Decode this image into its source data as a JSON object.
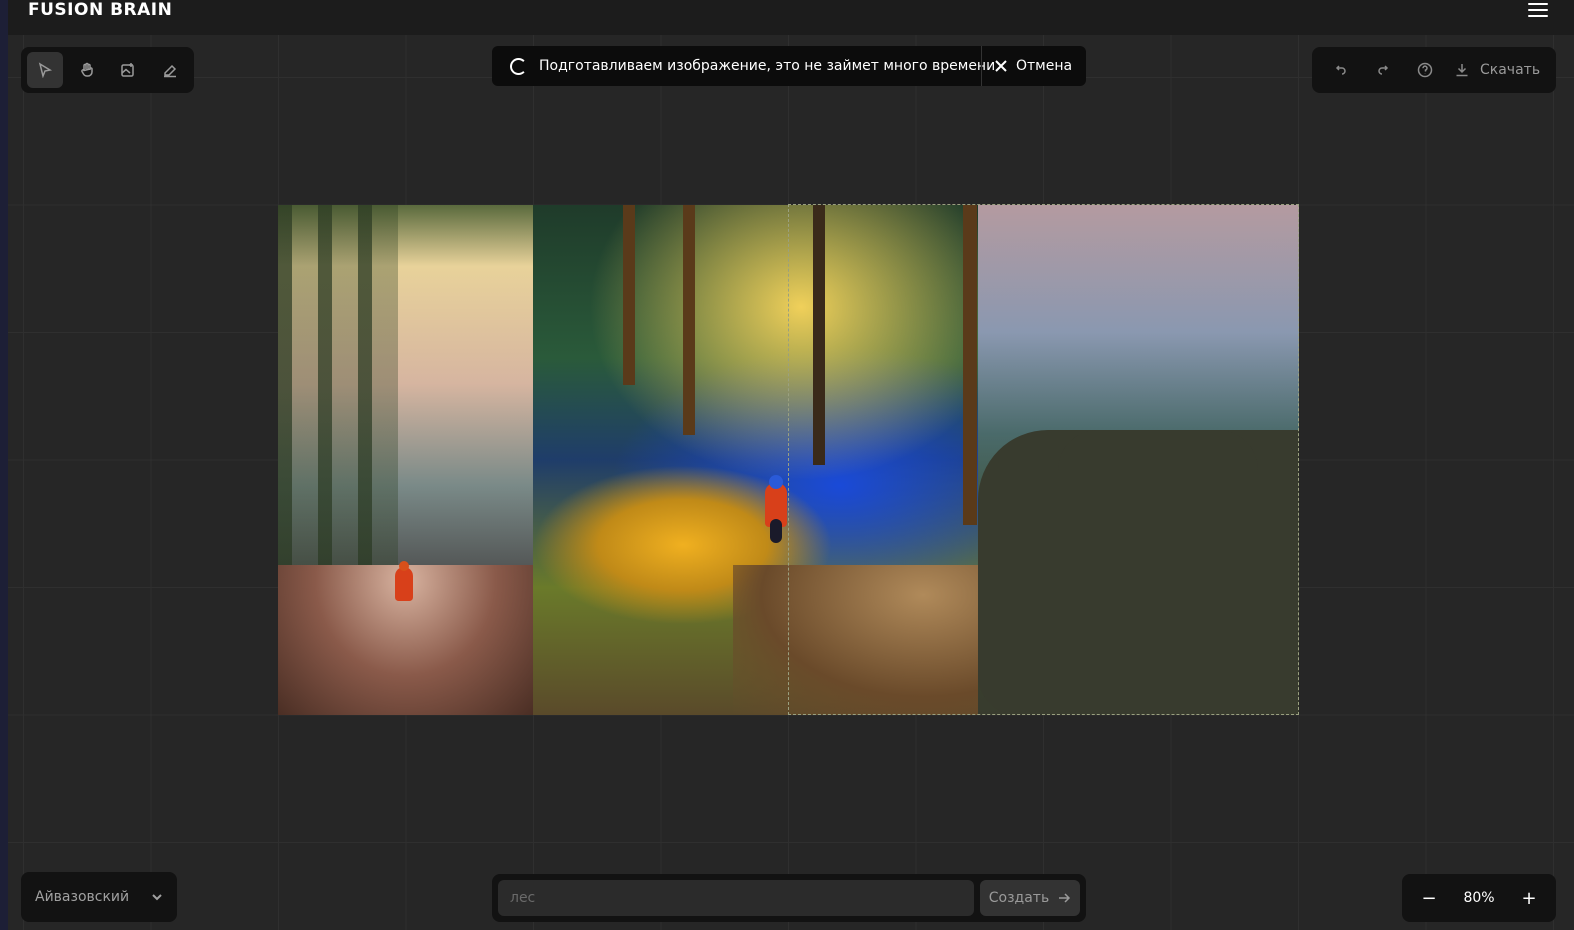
{
  "header": {
    "logo": "FUSION BRAIN",
    "menu_icon": "hamburger-menu-icon"
  },
  "toolbar": {
    "tools": [
      {
        "name": "select-tool",
        "icon": "cursor-arrow-icon",
        "active": true
      },
      {
        "name": "hand-tool",
        "icon": "hand-icon",
        "active": false
      },
      {
        "name": "add-image-tool",
        "icon": "image-plus-icon",
        "active": false
      },
      {
        "name": "eraser-tool",
        "icon": "eraser-icon",
        "active": false
      }
    ]
  },
  "status": {
    "message": "Подготавливаем изображение, это не займет много времени",
    "cancel_label": "Отмена"
  },
  "actions": {
    "undo_icon": "undo-icon",
    "redo_icon": "redo-icon",
    "help_icon": "help-circle-icon",
    "download_label": "Скачать"
  },
  "style_select": {
    "selected": "Айвазовский"
  },
  "prompt": {
    "placeholder": "лес",
    "value": "",
    "submit_label": "Создать"
  },
  "zoom": {
    "level": "80%",
    "minus": "−",
    "plus": "+"
  },
  "colors": {
    "background": "#262626",
    "panel": "#121212",
    "topbar": "#1c1c1c",
    "mask_fill": "#383b2e"
  }
}
